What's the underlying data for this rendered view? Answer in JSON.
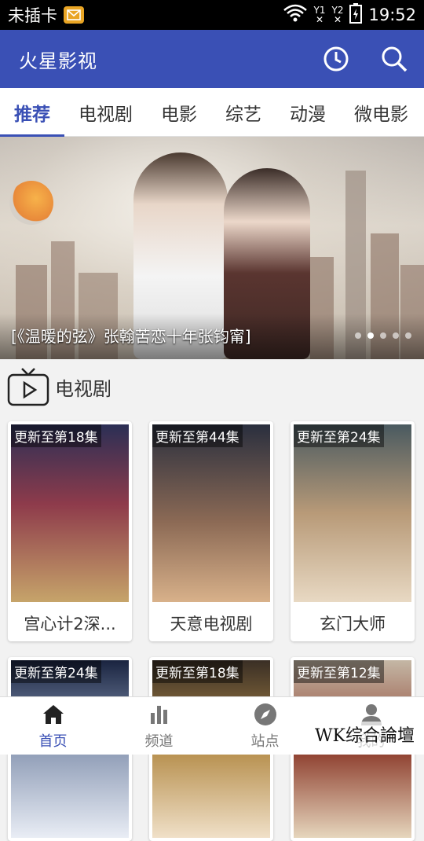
{
  "status_bar": {
    "carrier": "未插卡",
    "sim1": "Y1",
    "sim2": "Y2",
    "time": "19:52"
  },
  "app": {
    "title": "火星影视"
  },
  "tabs": [
    {
      "label": "推荐",
      "active": true
    },
    {
      "label": "电视剧",
      "active": false
    },
    {
      "label": "电影",
      "active": false
    },
    {
      "label": "综艺",
      "active": false
    },
    {
      "label": "动漫",
      "active": false
    },
    {
      "label": "微电影",
      "active": false
    }
  ],
  "banner": {
    "caption": "[《温暖的弦》张翰苦恋十年张钧甯]",
    "slide_count": 5,
    "active_slide": 2
  },
  "section": {
    "title": "电视剧"
  },
  "cards": [
    {
      "badge": "更新至第18集",
      "name": "宫心计2深...",
      "colors": [
        "#2b2f55",
        "#c6a46a",
        "#8e3b4b"
      ]
    },
    {
      "badge": "更新至第44集",
      "name": "天意电视剧",
      "colors": [
        "#2a2f3e",
        "#8c6a55",
        "#d8b18a"
      ]
    },
    {
      "badge": "更新至第24集",
      "name": "玄门大师",
      "colors": [
        "#4a5a60",
        "#b89a78",
        "#e8d9c3"
      ]
    },
    {
      "badge": "更新至第24集",
      "name": "",
      "colors": [
        "#1a2440",
        "#e9edf5",
        "#7a8aa8"
      ]
    },
    {
      "badge": "更新至第18集",
      "name": "",
      "colors": [
        "#3a2f25",
        "#b58d4a",
        "#f0e0c8"
      ]
    },
    {
      "badge": "更新至第12集",
      "name": "",
      "colors": [
        "#c4b7a5",
        "#8b3a2a",
        "#e6d6bd"
      ]
    }
  ],
  "bottom_nav": [
    {
      "label": "首页",
      "icon": "home-icon",
      "active": true
    },
    {
      "label": "频道",
      "icon": "bar-chart-icon",
      "active": false
    },
    {
      "label": "站点",
      "icon": "compass-icon",
      "active": false
    },
    {
      "label": "我的",
      "icon": "person-icon",
      "active": false
    }
  ],
  "watermark": "WK综合論壇",
  "accent_color": "#3a50b5"
}
